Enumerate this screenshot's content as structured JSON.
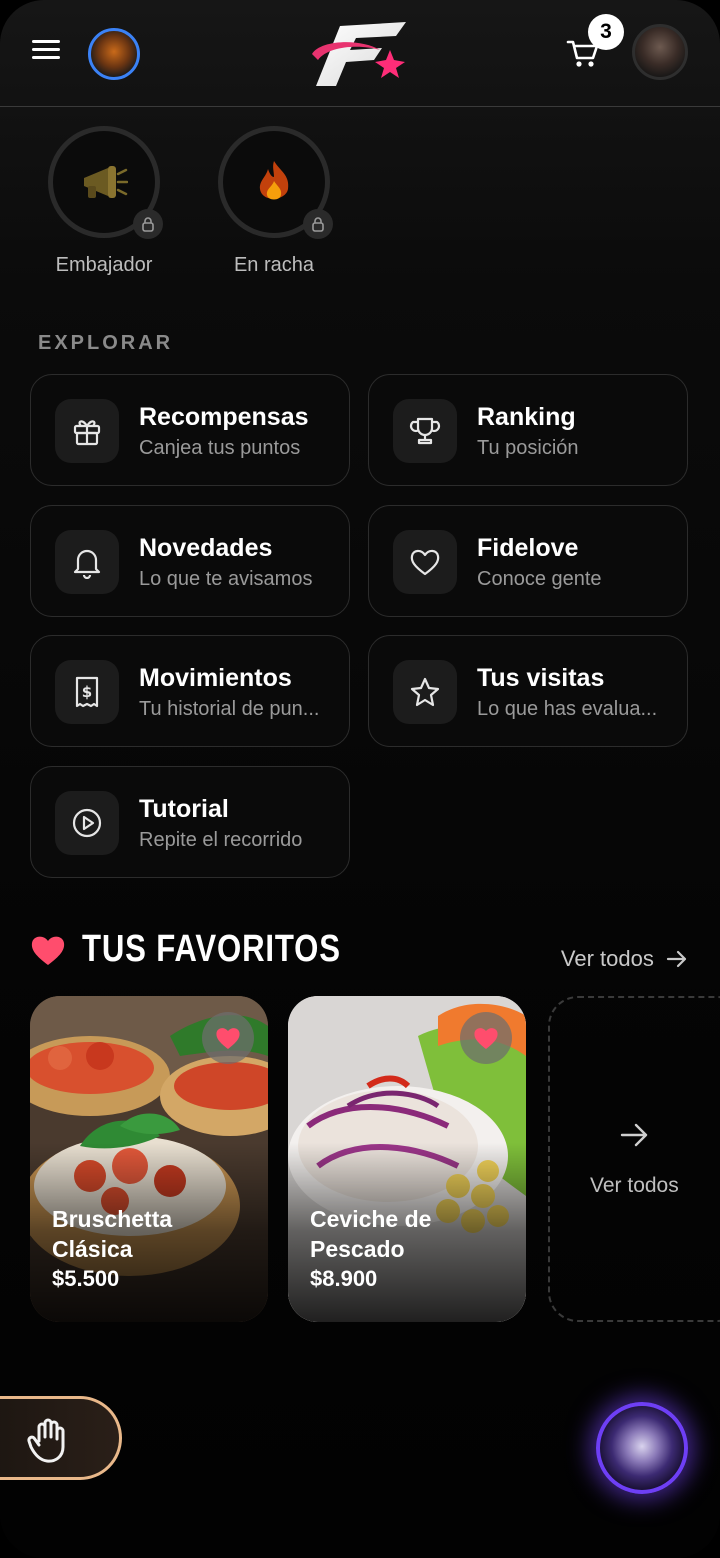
{
  "header": {
    "cart_count": "3"
  },
  "achievements": [
    {
      "label": "Embajador",
      "icon": "megaphone-icon",
      "locked": true
    },
    {
      "label": "En racha",
      "icon": "fire-icon",
      "locked": true
    }
  ],
  "explore": {
    "title": "EXPLORAR",
    "cards": [
      {
        "title": "Recompensas",
        "subtitle": "Canjea tus puntos",
        "icon": "gift-icon"
      },
      {
        "title": "Ranking",
        "subtitle": "Tu posición",
        "icon": "trophy-icon"
      },
      {
        "title": "Novedades",
        "subtitle": "Lo que te avisamos",
        "icon": "bell-icon"
      },
      {
        "title": "Fidelove",
        "subtitle": "Conoce gente",
        "icon": "heart-icon"
      },
      {
        "title": "Movimientos",
        "subtitle": "Tu historial de pun...",
        "icon": "receipt-icon"
      },
      {
        "title": "Tus visitas",
        "subtitle": "Lo que has evalua...",
        "icon": "star-icon"
      },
      {
        "title": "Tutorial",
        "subtitle": "Repite el recorrido",
        "icon": "play-icon"
      }
    ]
  },
  "favorites": {
    "title": "TUS FAVORITOS",
    "see_all": "Ver todos",
    "items": [
      {
        "name": "Bruschetta Clásica",
        "price": "$5.500"
      },
      {
        "name": "Ceviche de Pescado",
        "price": "$8.900"
      }
    ],
    "more_label": "Ver todos"
  },
  "colors": {
    "accent_heart": "#ff4d6d",
    "badge_ring": "#3b82f6",
    "orb_ring": "#6e3ff5",
    "hand_ring": "#e9b88a"
  }
}
